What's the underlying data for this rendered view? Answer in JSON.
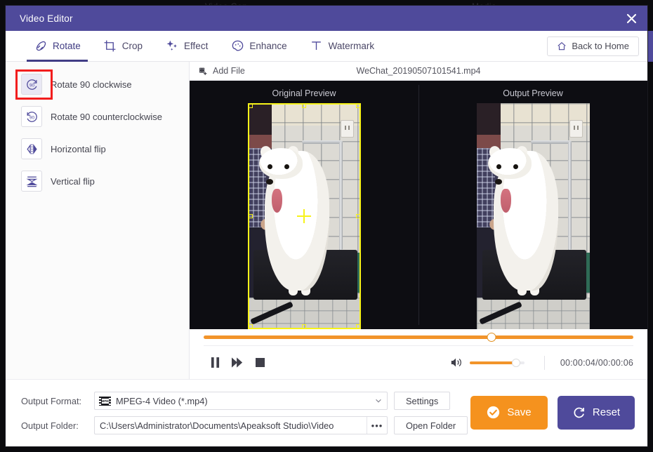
{
  "background": {
    "ghost_text_left": "Video Con...",
    "ghost_text_right": "Media..."
  },
  "window": {
    "title": "Video Editor",
    "close_icon": "close-icon"
  },
  "tabs": [
    {
      "label": "Rotate",
      "icon": "rotate-icon",
      "active": true
    },
    {
      "label": "Crop",
      "icon": "crop-icon",
      "active": false
    },
    {
      "label": "Effect",
      "icon": "sparkle-icon",
      "active": false
    },
    {
      "label": "Enhance",
      "icon": "palette-icon",
      "active": false
    },
    {
      "label": "Watermark",
      "icon": "text-t-icon",
      "active": false
    }
  ],
  "back_home": {
    "label": "Back to Home",
    "icon": "home-icon"
  },
  "sidebar": {
    "items": [
      {
        "label": "Rotate 90 clockwise",
        "icon": "rotate-cw-90-icon",
        "selected": true,
        "highlighted": true
      },
      {
        "label": "Rotate 90 counterclockwise",
        "icon": "rotate-ccw-90-icon",
        "selected": false,
        "highlighted": false
      },
      {
        "label": "Horizontal flip",
        "icon": "flip-horizontal-icon",
        "selected": false,
        "highlighted": false
      },
      {
        "label": "Vertical flip",
        "icon": "flip-vertical-icon",
        "selected": false,
        "highlighted": false
      }
    ]
  },
  "file_row": {
    "add_file_label": "Add File",
    "add_file_icon": "add-file-icon",
    "filename": "WeChat_20190507101541.mp4"
  },
  "preview": {
    "original_title": "Original Preview",
    "output_title": "Output Preview",
    "crop_overlay_color": "#f7f319"
  },
  "transport": {
    "timeline_percent": 67,
    "pause_icon": "pause-icon",
    "forward_icon": "fast-forward-icon",
    "stop_icon": "stop-icon",
    "volume_icon": "volume-icon",
    "volume_percent": 85,
    "timecode": "00:00:04/00:00:06"
  },
  "footer": {
    "output_format_label": "Output Format:",
    "output_format_value": "MPEG-4 Video (*.mp4)",
    "output_format_badge": "MPEG",
    "settings_label": "Settings",
    "output_folder_label": "Output Folder:",
    "output_folder_value": "C:\\Users\\Administrator\\Documents\\Apeaksoft Studio\\Video",
    "browse_label": "•••",
    "open_folder_label": "Open Folder",
    "save_label": "Save",
    "save_icon": "check-circle-icon",
    "reset_label": "Reset",
    "reset_icon": "refresh-icon"
  },
  "colors": {
    "accent_purple": "#4f4a9b",
    "accent_orange": "#f5921e",
    "highlight_red": "#f21d1d",
    "crop_yellow": "#f7f319"
  }
}
